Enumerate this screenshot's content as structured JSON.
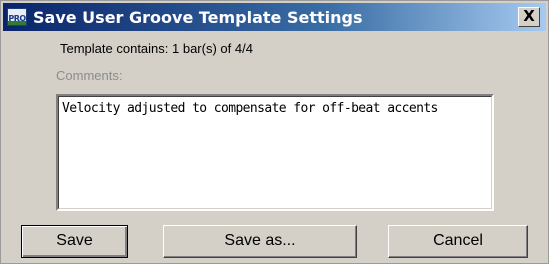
{
  "window": {
    "title": "Save User Groove Template Settings",
    "app_icon_label": "PRO",
    "close_label": "X"
  },
  "template": {
    "info": "Template contains: 1 bar(s) of 4/4"
  },
  "comments": {
    "label": "Comments:",
    "value": "Velocity adjusted to compensate for off-beat accents"
  },
  "buttons": {
    "save": "Save",
    "save_as": "Save as...",
    "cancel": "Cancel"
  }
}
